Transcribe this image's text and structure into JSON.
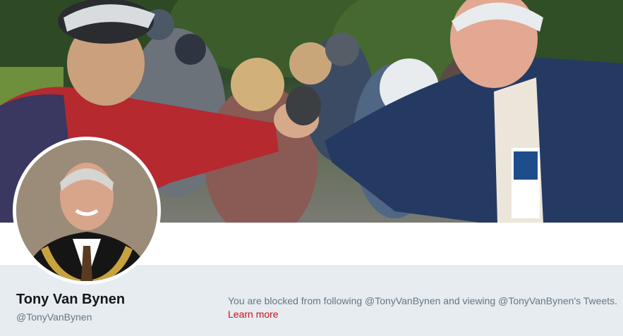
{
  "profile": {
    "display_name": "Tony Van Bynen",
    "screen_name": "@TonyVanBynen"
  },
  "blocked_notice": {
    "message": "You are blocked from following @TonyVanBynen and viewing @TonyVanBynen's Tweets.",
    "learn_more_label": "Learn more"
  },
  "colors": {
    "profile_bar_bg": "#e6ecf0",
    "link_color": "#c3121c",
    "muted_text": "#657786"
  }
}
